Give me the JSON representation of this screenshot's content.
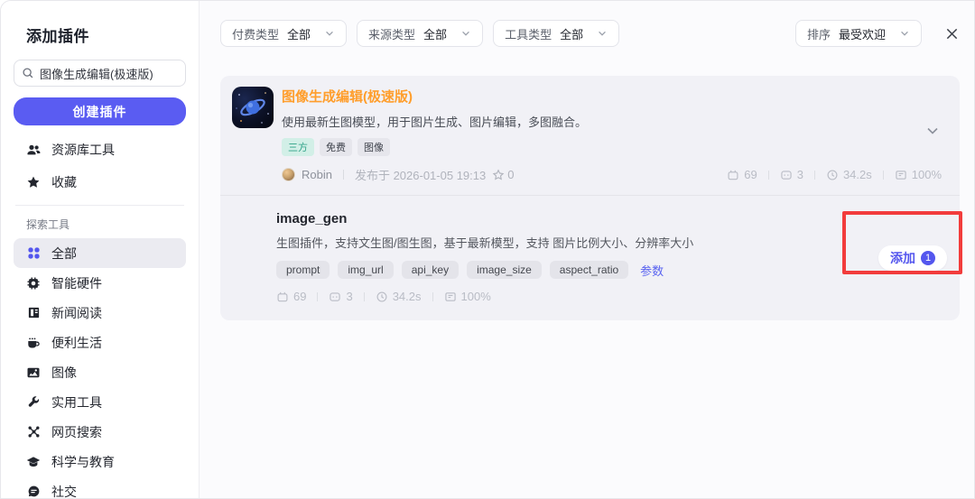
{
  "sidebar": {
    "title": "添加插件",
    "search_value": "图像生成编辑(极速版)",
    "create_button": "创建插件",
    "library": [
      {
        "icon": "users-icon",
        "label": "资源库工具"
      },
      {
        "icon": "star-icon",
        "label": "收藏"
      }
    ],
    "section_label": "探索工具",
    "categories": [
      {
        "icon": "grid-icon",
        "label": "全部",
        "active": true
      },
      {
        "icon": "chip-icon",
        "label": "智能硬件"
      },
      {
        "icon": "news-icon",
        "label": "新闻阅读"
      },
      {
        "icon": "cup-icon",
        "label": "便利生活"
      },
      {
        "icon": "image-icon",
        "label": "图像"
      },
      {
        "icon": "wrench-icon",
        "label": "实用工具"
      },
      {
        "icon": "web-search-icon",
        "label": "网页搜索"
      },
      {
        "icon": "education-icon",
        "label": "科学与教育"
      },
      {
        "icon": "chat-icon",
        "label": "社交"
      }
    ]
  },
  "topbar": {
    "filters": [
      {
        "label": "付费类型",
        "value": "全部"
      },
      {
        "label": "来源类型",
        "value": "全部"
      },
      {
        "label": "工具类型",
        "value": "全部"
      }
    ],
    "sort": {
      "label": "排序",
      "value": "最受欢迎"
    }
  },
  "plugin": {
    "title": "图像生成编辑(极速版)",
    "description": "使用最新生图模型，用于图片生成、图片编辑，多图融合。",
    "tags": [
      {
        "label": "三方",
        "style": "teal"
      },
      {
        "label": "免费",
        "style": "gray"
      },
      {
        "label": "图像",
        "style": "gray"
      }
    ],
    "author": "Robin",
    "published": "发布于 2026-01-05 19:13",
    "stars": "0",
    "stats": [
      {
        "icon": "bot-runs-icon",
        "value": "69"
      },
      {
        "icon": "bot-face-icon",
        "value": "3"
      },
      {
        "icon": "clock-icon",
        "value": "34.2s"
      },
      {
        "icon": "success-rate-icon",
        "value": "100%"
      }
    ]
  },
  "tool": {
    "name": "image_gen",
    "description": "生图插件，支持文生图/图生图，基于最新模型，支持 图片比例大小、分辨率大小",
    "params": [
      "prompt",
      "img_url",
      "api_key",
      "image_size",
      "aspect_ratio"
    ],
    "params_link": "参数",
    "stats": [
      {
        "icon": "bot-runs-icon",
        "value": "69"
      },
      {
        "icon": "bot-face-icon",
        "value": "3"
      },
      {
        "icon": "clock-icon",
        "value": "34.2s"
      },
      {
        "icon": "success-rate-icon",
        "value": "100%"
      }
    ],
    "add_button": {
      "label": "添加",
      "badge": "1"
    }
  },
  "colors": {
    "accent": "#5a5cf2",
    "plugin_title": "#ff9e2c",
    "annotation": "#f23c3c",
    "teal_tag_bg": "#d2efe7",
    "teal_tag_text": "#2fa287"
  }
}
